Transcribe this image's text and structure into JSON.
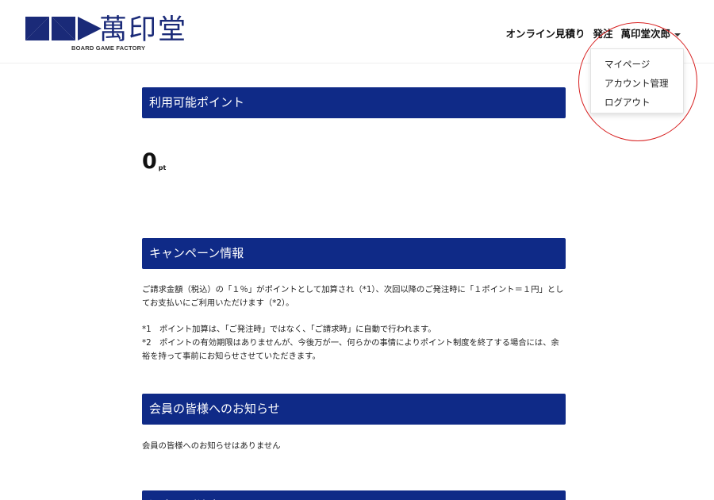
{
  "brand": {
    "name": "萬印堂",
    "subtitle": "BOARD GAME FACTORY",
    "color": "#1a2a78"
  },
  "nav": {
    "items": [
      "オンライン見積り",
      "発注"
    ],
    "user_name": "萬印堂次郎"
  },
  "dropdown": {
    "items": [
      "マイページ",
      "アカウント管理",
      "ログアウト"
    ]
  },
  "sections": {
    "points": {
      "title": "利用可能ポイント",
      "value": "0",
      "unit": "pt"
    },
    "campaign": {
      "title": "キャンペーン情報",
      "body": "ご請求金額（税込）の「１％」がポイントとして加算され（*1）、次回以降のご発注時に「１ポイント＝１円」としてお支払いにご利用いただけます（*2）。",
      "note1": "*1　ポイント加算は、「ご発注時」ではなく、「ご請求時」に自動で行われます。",
      "note2": "*2　ポイントの有効期限はありませんが、今後万が一、何らかの事情によりポイント制度を終了する場合には、余裕を持って事前にお知らせさせていただきます。"
    },
    "news": {
      "title": "会員の皆様へのお知らせ",
      "body": "会員の皆様へのお知らせはありません"
    },
    "orders": {
      "title": "過去のご注文"
    }
  },
  "colors": {
    "section_header": "#0f2a87",
    "annotation": "#d71f1f"
  }
}
